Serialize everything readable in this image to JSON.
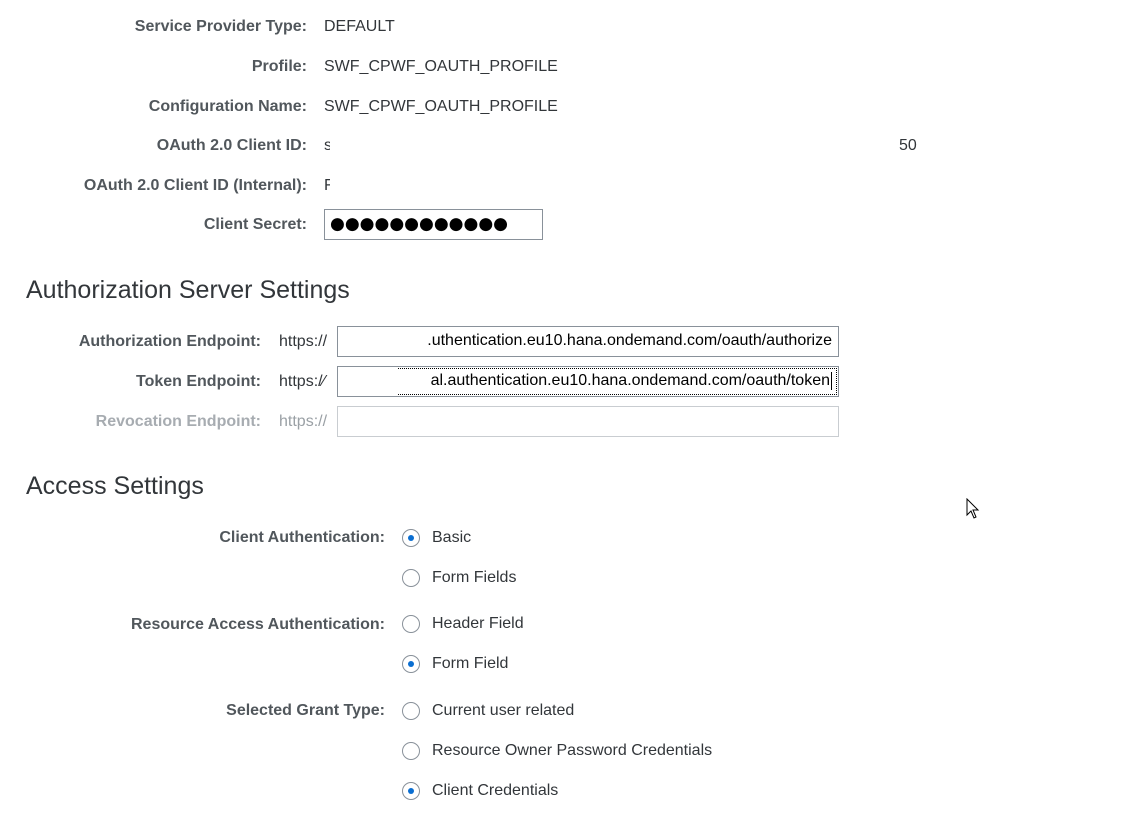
{
  "provider": {
    "service_provider_type_label": "Service Provider Type:",
    "service_provider_type_value": "DEFAULT",
    "profile_label": "Profile:",
    "profile_value": "SWF_CPWF_OAUTH_PROFILE",
    "configuration_name_label": "Configuration Name:",
    "configuration_name_value": "SWF_CPWF_OAUTH_PROFILE",
    "client_id_label": "OAuth 2.0 Client ID:",
    "client_id_value_start": "s",
    "client_id_value_end": "50",
    "client_id_internal_label": "OAuth 2.0 Client ID (Internal):",
    "client_id_internal_value_start": "F",
    "client_secret_label": "Client Secret:",
    "client_secret_value": "●●●●●●●●●●●●"
  },
  "authorization_server": {
    "title": "Authorization Server Settings",
    "authorization_endpoint_label": "Authorization Endpoint:",
    "authorization_endpoint_prefix": "https://",
    "authorization_endpoint_value": ".uthentication.eu10.hana.ondemand.com/oauth/authorize",
    "token_endpoint_label": "Token Endpoint:",
    "token_endpoint_prefix": "https:/⁄",
    "token_endpoint_value": "al.authentication.eu10.hana.ondemand.com/oauth/token",
    "revocation_endpoint_label": "Revocation Endpoint:",
    "revocation_endpoint_prefix": "https://",
    "revocation_endpoint_value": ""
  },
  "access_settings": {
    "title": "Access Settings",
    "client_authentication_label": "Client Authentication:",
    "client_authentication_options": [
      {
        "label": "Basic",
        "checked": true
      },
      {
        "label": "Form Fields",
        "checked": false
      }
    ],
    "resource_access_label": "Resource Access Authentication:",
    "resource_access_options": [
      {
        "label": "Header Field",
        "checked": false
      },
      {
        "label": "Form Field",
        "checked": true
      }
    ],
    "grant_type_label": "Selected Grant Type:",
    "grant_type_options": [
      {
        "label": "Current user related",
        "checked": false
      },
      {
        "label": "Resource Owner Password Credentials",
        "checked": false
      },
      {
        "label": "Client Credentials",
        "checked": true
      }
    ]
  },
  "colors": {
    "accent": "#0a6ed1",
    "label": "#51575c",
    "text": "#32363a",
    "border": "#89919a"
  }
}
